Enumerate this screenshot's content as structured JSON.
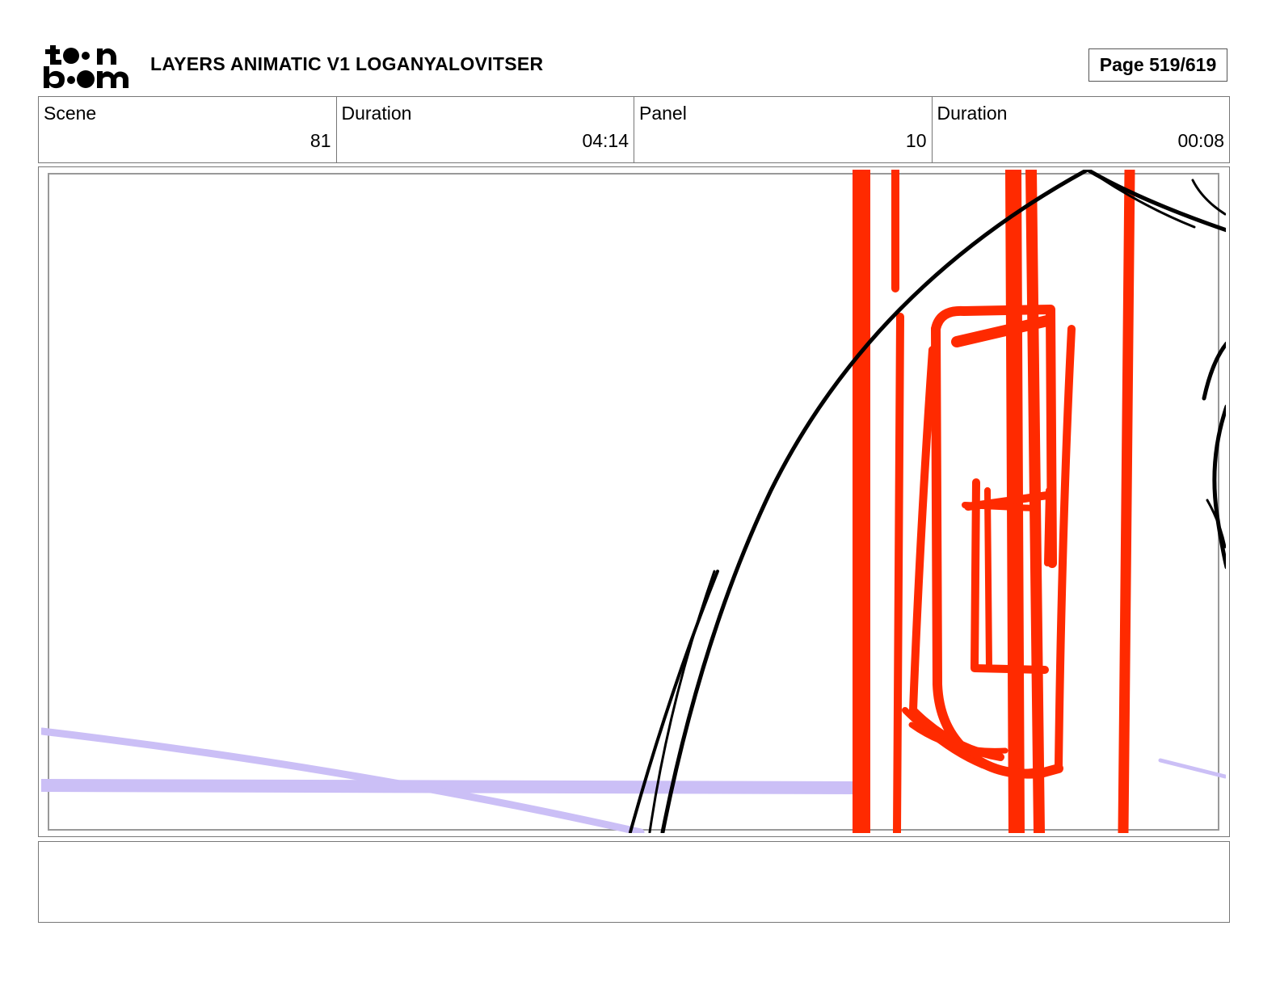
{
  "header": {
    "logo": "toonboom-logo",
    "title": "LAYERS ANIMATIC V1 LOGANYALOVITSER",
    "page": "Page 519/619"
  },
  "info": {
    "scene_label": "Scene",
    "scene_value": "81",
    "scene_duration_label": "Duration",
    "scene_duration_value": "04:14",
    "panel_label": "Panel",
    "panel_value": "10",
    "panel_duration_label": "Duration",
    "panel_duration_value": "00:08"
  },
  "drawing": {
    "stroke_colors": {
      "black": "#000000",
      "red": "#ff2a00",
      "lavender": "#cbbff6",
      "frame": "#888888"
    }
  },
  "notes": {
    "text": ""
  }
}
